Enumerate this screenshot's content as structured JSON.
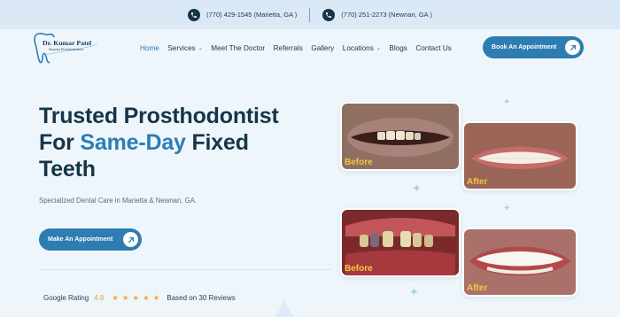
{
  "topbar": {
    "phone1": "(770) 429-1545 (Marietta, GA )",
    "phone2": "(770) 251-2273 (Newnan, GA )"
  },
  "logo": {
    "name": "Dr. Kumar Patel",
    "tagline": "Smyrna Prosthodontics"
  },
  "nav": {
    "items": [
      {
        "label": "Home"
      },
      {
        "label": "Services"
      },
      {
        "label": "Meet The Doctor"
      },
      {
        "label": "Referrals"
      },
      {
        "label": "Gallery"
      },
      {
        "label": "Locations"
      },
      {
        "label": "Blogs"
      },
      {
        "label": "Contact Us"
      }
    ],
    "cta": "Book An Appointment"
  },
  "hero": {
    "title_line1": "Trusted Prosthodontist",
    "title_for": "For ",
    "title_highlight": "Same-Day",
    "title_after": " Fixed",
    "title_line3": "Teeth",
    "subtitle": "Specialized Dental Care in Marietta & Newnan, GA.",
    "cta": "Make An Appointment"
  },
  "rating": {
    "label": "Google Rating",
    "score": "4.8",
    "stars": "★★★★★",
    "reviews": "Based on 30 Reviews"
  },
  "gallery": {
    "before_label": "Before",
    "after_label": "After"
  },
  "colors": {
    "primary": "#2d7db3",
    "dark": "#163548",
    "background": "#eef6fc",
    "caption": "#f3c744"
  }
}
